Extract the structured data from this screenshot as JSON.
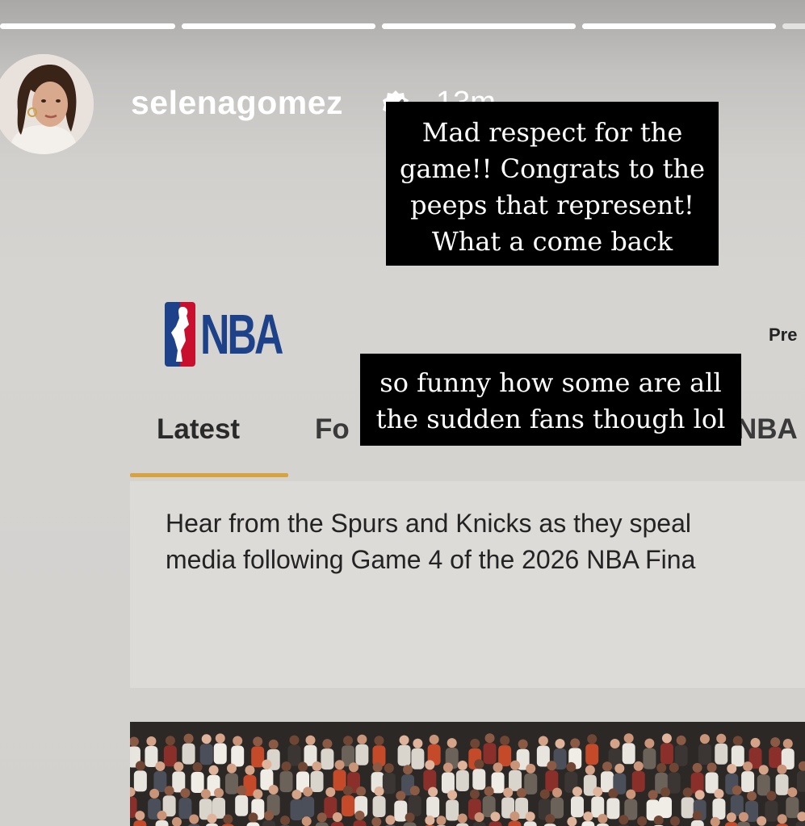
{
  "story": {
    "progress": [
      1,
      1,
      1,
      1,
      0
    ],
    "username": "selenagomez",
    "timestamp": "13m",
    "verified_icon": "verified-badge-icon",
    "avatar_icon": "profile-avatar"
  },
  "captions": {
    "first": [
      "Mad respect for the",
      "game!! Congrats to the",
      "peeps that represent!",
      "What a come back"
    ],
    "second": [
      "so funny how some are all",
      "the sudden fans though lol"
    ]
  },
  "nba": {
    "logo_text": "NBA",
    "nav_partial": "Pre",
    "tabs": {
      "latest": "Latest",
      "partial_second": "Fo",
      "partial_third": "NBA"
    },
    "article_lines": [
      "Hear from the Spurs and Knicks as they speal",
      "media following Game 4 of the 2026 NBA Fina"
    ],
    "colors": {
      "brand_blue": "#1d428a",
      "brand_red": "#c8102e",
      "tab_accent": "#d8a23c"
    }
  }
}
